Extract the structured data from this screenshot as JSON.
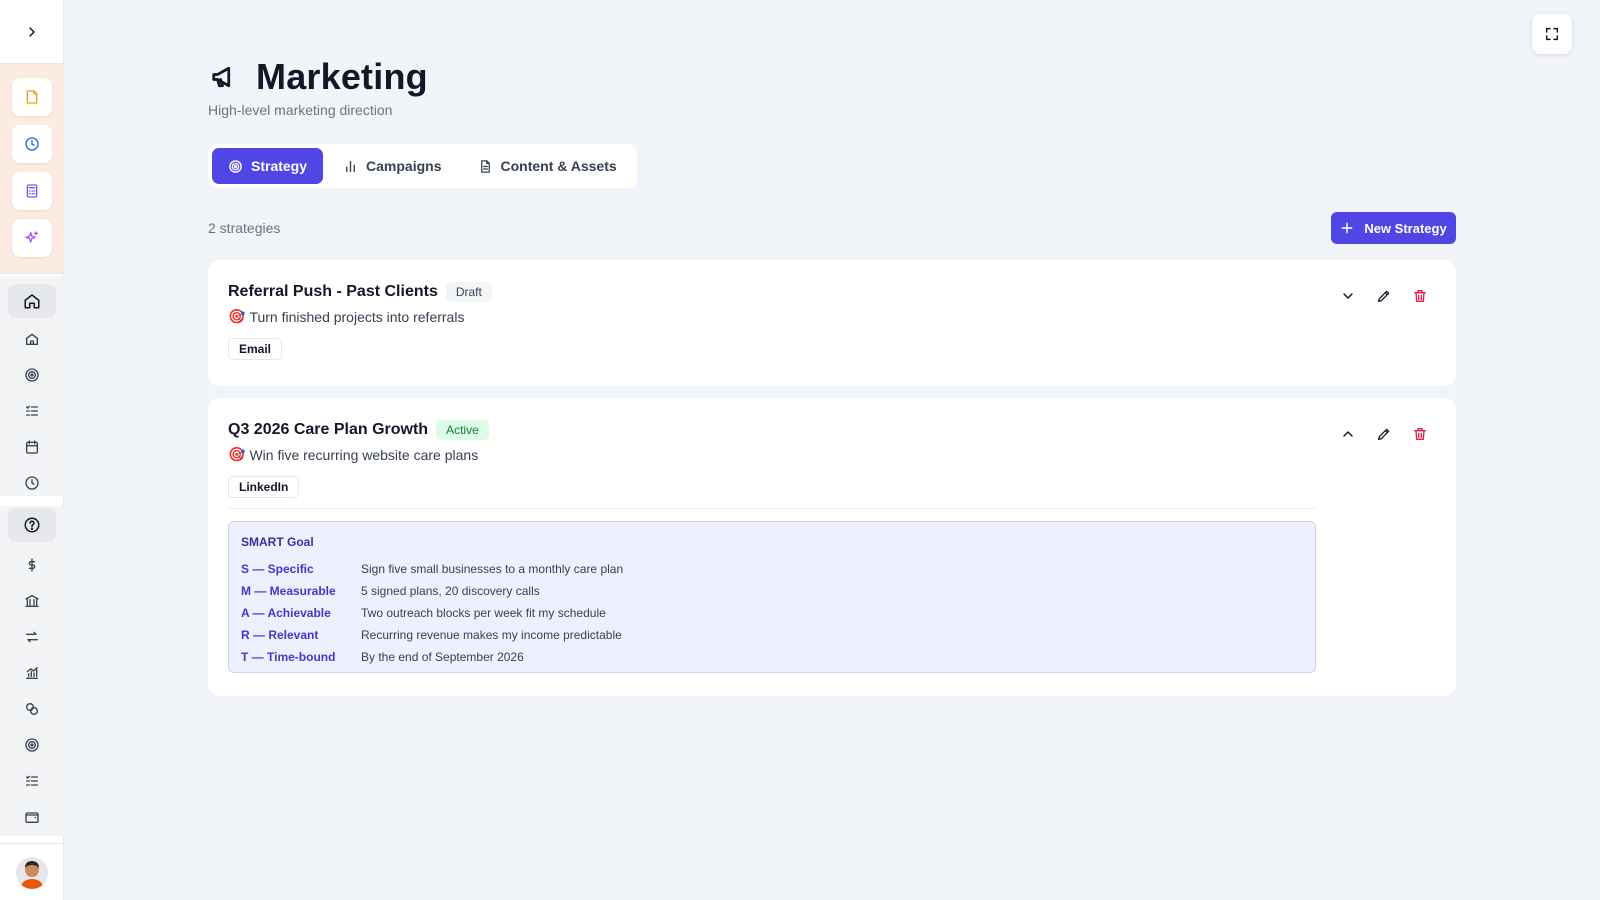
{
  "page": {
    "title": "Marketing",
    "subtitle": "High-level marketing direction",
    "title_icon": "megaphone-icon"
  },
  "tabs": [
    {
      "label": "Strategy",
      "icon": "target-icon",
      "active": true
    },
    {
      "label": "Campaigns",
      "icon": "bar-chart-icon",
      "active": false
    },
    {
      "label": "Content & Assets",
      "icon": "document-icon",
      "active": false
    }
  ],
  "toolbar": {
    "count_label": "2 strategies",
    "new_button_label": "New Strategy"
  },
  "strategies": [
    {
      "title": "Referral Push - Past Clients",
      "status": "Draft",
      "goal": "Turn finished projects into referrals",
      "goal_icon": "🎯",
      "channel": "Email",
      "expanded": false
    },
    {
      "title": "Q3 2026 Care Plan Growth",
      "status": "Active",
      "goal": "Win five recurring website care plans",
      "goal_icon": "🎯",
      "channel": "LinkedIn",
      "expanded": true,
      "smart": {
        "title": "SMART Goal",
        "rows": [
          {
            "key": "S — Specific",
            "value": "Sign five small businesses to a monthly care plan"
          },
          {
            "key": "M — Measurable",
            "value": "5 signed plans, 20 discovery calls"
          },
          {
            "key": "A — Achievable",
            "value": "Two outreach blocks per week fit my schedule"
          },
          {
            "key": "R — Relevant",
            "value": "Recurring revenue makes my income predictable"
          },
          {
            "key": "T — Time-bound",
            "value": "By the end of September 2026"
          }
        ]
      }
    }
  ],
  "colors": {
    "accent": "#4f46e5",
    "background": "#f1f4f8",
    "delete": "#e11d48",
    "active_badge_bg": "#dcfce7",
    "active_badge_text": "#15803d",
    "apps_panel_bg": "#fcebe1"
  },
  "sidebar": {
    "toggle_icon": "chevron-right-icon",
    "apps": [
      "notes-icon",
      "clock-icon",
      "calculator-icon",
      "sparkle-icon"
    ],
    "nav": [
      "home-icon",
      "house-icon",
      "target-icon",
      "checklist-icon",
      "calendar-icon",
      "clock-icon",
      "help-icon",
      "dollar-icon",
      "bank-icon",
      "transfer-icon",
      "chart-icon",
      "coins-icon",
      "target-icon",
      "checklist-icon",
      "wallet-icon"
    ]
  }
}
